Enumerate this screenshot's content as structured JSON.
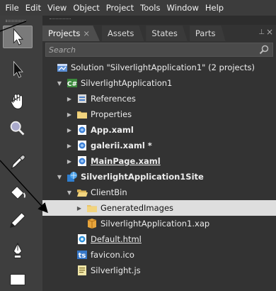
{
  "menu": [
    "File",
    "Edit",
    "View",
    "Object",
    "Project",
    "Tools",
    "Window",
    "Help"
  ],
  "panel": {
    "tabs": [
      {
        "label": "Projects",
        "close": "×",
        "active": true
      },
      {
        "label": "Assets",
        "active": false
      },
      {
        "label": "States",
        "active": false
      },
      {
        "label": "Parts",
        "active": false
      }
    ],
    "pin_glyph": "⊥",
    "close_glyph": "×",
    "search_placeholder": "Search"
  },
  "tree": [
    {
      "label": "Solution \"SilverlightApplication1\" (2 projects)",
      "icon": "solution-icon",
      "indent": 0,
      "arrow": "",
      "bold": false,
      "underline": false
    },
    {
      "label": "SilverlightApplication1",
      "icon": "cs-project-icon",
      "indent": 1,
      "arrow": "▼",
      "bold": false,
      "underline": false
    },
    {
      "label": "References",
      "icon": "references-icon",
      "indent": 2,
      "arrow": "▶",
      "bold": false,
      "underline": false
    },
    {
      "label": "Properties",
      "icon": "folder-icon",
      "indent": 2,
      "arrow": "▶",
      "bold": false,
      "underline": false
    },
    {
      "label": "App.xaml",
      "icon": "xaml-icon",
      "indent": 2,
      "arrow": "▶",
      "bold": true,
      "underline": false
    },
    {
      "label": "galerii.xaml *",
      "icon": "xaml-icon",
      "indent": 2,
      "arrow": "▶",
      "bold": true,
      "underline": false
    },
    {
      "label": "MainPage.xaml",
      "icon": "xaml-icon",
      "indent": 2,
      "arrow": "▶",
      "bold": true,
      "underline": true
    },
    {
      "label": "SilverlightApplication1Site",
      "icon": "web-project-icon",
      "indent": 1,
      "arrow": "▼",
      "bold": true,
      "underline": false
    },
    {
      "label": "ClientBin",
      "icon": "folder-open-icon",
      "indent": 2,
      "arrow": "▼",
      "bold": false,
      "underline": false
    },
    {
      "label": "GeneratedImages",
      "icon": "folder-icon",
      "indent": 3,
      "arrow": "▶",
      "bold": false,
      "underline": false,
      "selected": true
    },
    {
      "label": "SilverlightApplication1.xap",
      "icon": "xap-icon",
      "indent": 3,
      "arrow": "",
      "bold": false,
      "underline": false
    },
    {
      "label": "Default.html",
      "icon": "html-icon",
      "indent": 2,
      "arrow": "",
      "bold": false,
      "underline": true
    },
    {
      "label": "favicon.ico",
      "icon": "ico-file-icon",
      "indent": 2,
      "arrow": "",
      "bold": false,
      "underline": false
    },
    {
      "label": "Silverlight.js",
      "icon": "js-file-icon",
      "indent": 2,
      "arrow": "",
      "bold": false,
      "underline": false
    }
  ],
  "tools": [
    {
      "name": "selection-tool-icon",
      "active": true
    },
    {
      "name": "direct-selection-tool-icon",
      "active": false
    },
    {
      "name": "pan-tool-icon",
      "active": false
    },
    {
      "name": "zoom-tool-icon",
      "active": false
    },
    {
      "name": "eyedropper-tool-icon",
      "active": false
    },
    {
      "name": "paint-bucket-tool-icon",
      "active": false
    },
    {
      "name": "pencil-tool-icon",
      "active": false
    },
    {
      "name": "pen-tool-icon",
      "active": false
    },
    {
      "name": "rectangle-tool-icon",
      "active": false
    }
  ],
  "colors": {
    "selected_row": "#dedede",
    "panel": "#333333",
    "toolbar": "#3e3e3e"
  }
}
